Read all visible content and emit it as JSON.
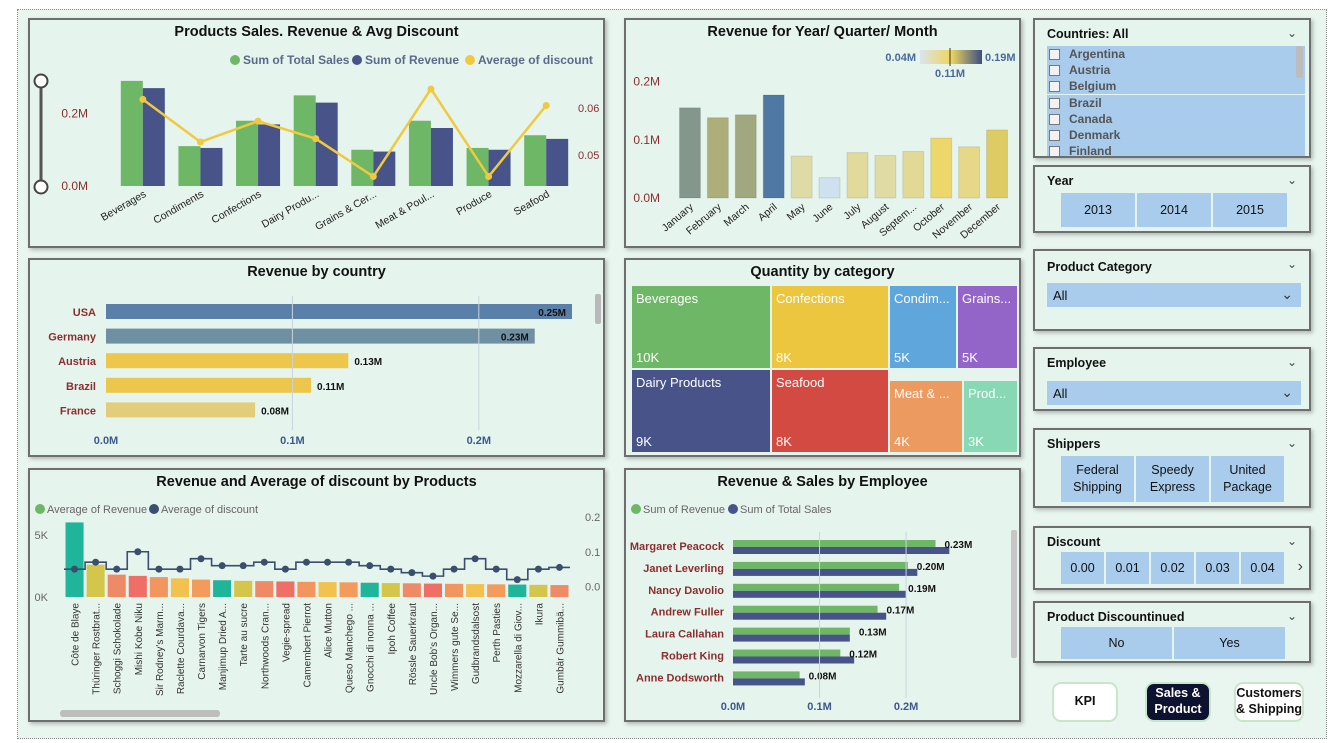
{
  "colors": {
    "green": "#6db766",
    "navy": "#475389",
    "gold": "#f0c93e",
    "maroon": "#9b3a37",
    "label": "#8b2e2e",
    "slicer_tile": "#a9ccec"
  },
  "panels": {
    "sales_revenue_discount": {
      "title": "Products Sales. Revenue & Avg Discount",
      "legend": [
        "Sum of Total Sales",
        "Sum of Revenue",
        "Average of discount"
      ],
      "y_left_ticks": [
        "0.2M",
        "0.0M"
      ],
      "y_right_ticks": [
        "0.06",
        "0.05"
      ]
    },
    "revenue_period": {
      "title": "Revenue for Year/ Quarter/ Month",
      "gradient_min": "0.04M",
      "gradient_mid": "0.11M",
      "gradient_max": "0.19M",
      "y_ticks": [
        "0.2M",
        "0.1M",
        "0.0M"
      ]
    },
    "revenue_country": {
      "title": "Revenue by country",
      "x_ticks": [
        "0.0M",
        "0.1M",
        "0.2M"
      ]
    },
    "quantity_category": {
      "title": "Quantity by category"
    },
    "revenue_discount_products": {
      "title": "Revenue and Average of discount by Products",
      "legend": [
        "Average of Revenue",
        "Average of discount"
      ],
      "y_left_ticks": [
        "5K",
        "0K"
      ],
      "y_right_ticks": [
        "0.2",
        "0.1",
        "0.0"
      ]
    },
    "revenue_sales_employee": {
      "title": "Revenue & Sales by Employee",
      "legend": [
        "Sum of Revenue",
        "Sum of Total Sales"
      ],
      "x_ticks": [
        "0.0M",
        "0.1M",
        "0.2M"
      ]
    }
  },
  "chart_data": [
    {
      "type": "bar",
      "title": "Products Sales. Revenue & Avg Discount",
      "categories": [
        "Beverages",
        "Condiments",
        "Confections",
        "Dairy Produ...",
        "Grains & Cer...",
        "Meat & Poul...",
        "Produce",
        "Seafood"
      ],
      "series": [
        {
          "name": "Sum of Total Sales",
          "values": [
            0.29,
            0.11,
            0.18,
            0.25,
            0.1,
            0.18,
            0.105,
            0.14
          ]
        },
        {
          "name": "Sum of Revenue",
          "values": [
            0.27,
            0.105,
            0.17,
            0.23,
            0.095,
            0.16,
            0.1,
            0.13
          ]
        },
        {
          "name": "Average of discount",
          "values": [
            0.0618,
            0.0528,
            0.0572,
            0.0535,
            0.0455,
            0.064,
            0.0455,
            0.0605
          ]
        }
      ],
      "ylim": [
        0,
        0.32
      ],
      "y2lim": [
        0.0435,
        0.068
      ]
    },
    {
      "type": "bar",
      "title": "Revenue for Year/ Quarter/ Month",
      "categories": [
        "January",
        "February",
        "March",
        "April",
        "May",
        "June",
        "July",
        "August",
        "Septem...",
        "October",
        "November",
        "December"
      ],
      "values": [
        0.155,
        0.138,
        0.143,
        0.177,
        0.072,
        0.035,
        0.078,
        0.073,
        0.08,
        0.103,
        0.088,
        0.117
      ],
      "ylim": [
        0,
        0.22
      ]
    },
    {
      "type": "bar",
      "title": "Revenue by country",
      "categories": [
        "USA",
        "Germany",
        "Austria",
        "Brazil",
        "France"
      ],
      "values": [
        0.25,
        0.23,
        0.13,
        0.11,
        0.08
      ],
      "labels": [
        "0.25M",
        "0.23M",
        "0.13M",
        "0.11M",
        "0.08M"
      ],
      "xlim": [
        0,
        0.25
      ]
    },
    {
      "type": "heatmap",
      "title": "Quantity by category",
      "cells": [
        {
          "label": "Beverages",
          "value": "10K",
          "color": "#6db766"
        },
        {
          "label": "Confections",
          "value": "8K",
          "color": "#ecc63e"
        },
        {
          "label": "Condim...",
          "value": "5K",
          "color": "#5fa6dc"
        },
        {
          "label": "Grains...",
          "value": "5K",
          "color": "#9465c9"
        },
        {
          "label": "Dairy Products",
          "value": "9K",
          "color": "#475389"
        },
        {
          "label": "Seafood",
          "value": "8K",
          "color": "#d24a42"
        },
        {
          "label": "Meat & ...",
          "value": "4K",
          "color": "#ec9a60"
        },
        {
          "label": "Prod...",
          "value": "3K",
          "color": "#88d7b5"
        }
      ]
    },
    {
      "type": "bar",
      "title": "Revenue and Average of discount by Products",
      "categories": [
        "Côte de Blaye",
        "Thüringer Rostbrat...",
        "Schoggi Schokolade",
        "Mishi Kobe Niku",
        "Sir Rodney's Marm...",
        "Raclette Courdava...",
        "Carnarvon Tigers",
        "Manjimup Dried A...",
        "Tarte au sucre",
        "Northwoods Cran...",
        "Vegie-spread",
        "Camembert Pierrot",
        "Alice Mutton",
        "Queso Manchego ...",
        "Gnocchi di nonna ...",
        "Ipoh Coffee",
        "Rössle Sauerkraut",
        "Uncle Bob's Organ...",
        "Wimmers gute Se...",
        "Gudbrandsdalsost",
        "Perth Pasties",
        "Mozzarella di Giov...",
        "Ikura",
        "Gumbär Gummibä..."
      ],
      "series": [
        {
          "name": "Average of Revenue",
          "values": [
            6000,
            2600,
            1800,
            1700,
            1600,
            1500,
            1400,
            1350,
            1300,
            1280,
            1250,
            1220,
            1200,
            1180,
            1150,
            1120,
            1100,
            1080,
            1060,
            1040,
            1020,
            1000,
            980,
            960
          ]
        },
        {
          "name": "Average of discount",
          "values": [
            0.05,
            0.07,
            0.05,
            0.1,
            0.05,
            0.05,
            0.08,
            0.06,
            0.06,
            0.07,
            0.05,
            0.07,
            0.07,
            0.07,
            0.06,
            0.05,
            0.04,
            0.03,
            0.05,
            0.08,
            0.05,
            0.02,
            0.05,
            0.055
          ]
        }
      ],
      "ylim": [
        0,
        7000
      ],
      "y2lim": [
        -0.03,
        0.22
      ]
    },
    {
      "type": "bar",
      "title": "Revenue & Sales by Employee",
      "categories": [
        "Margaret Peacock",
        "Janet Leverling",
        "Nancy Davolio",
        "Andrew Fuller",
        "Laura Callahan",
        "Robert King",
        "Anne Dodsworth"
      ],
      "series": [
        {
          "name": "Sum of Revenue",
          "values": [
            0.234,
            0.202,
            0.192,
            0.167,
            0.135,
            0.124,
            0.077
          ]
        },
        {
          "name": "Sum of Total Sales",
          "values": [
            0.25,
            0.213,
            0.2,
            0.177,
            0.135,
            0.14,
            0.083
          ]
        }
      ],
      "labels": [
        "0.23M",
        "0.20M",
        "0.19M",
        "0.17M",
        "0.13M",
        "0.12M",
        "0.08M"
      ],
      "xlim": [
        0,
        0.26
      ]
    }
  ],
  "slicers": {
    "countries": {
      "title": "Countries: All",
      "items": [
        "Argentina",
        "Austria",
        "Belgium",
        "Brazil",
        "Canada",
        "Denmark",
        "Finland"
      ]
    },
    "year": {
      "title": "Year",
      "options": [
        "2013",
        "2014",
        "2015"
      ]
    },
    "product_category": {
      "title": "Product Category",
      "value": "All"
    },
    "employee": {
      "title": "Employee",
      "value": "All"
    },
    "shippers": {
      "title": "Shippers",
      "options": [
        "Federal Shipping",
        "Speedy Express",
        "United Package"
      ]
    },
    "discount": {
      "title": "Discount",
      "options": [
        "0.00",
        "0.01",
        "0.02",
        "0.03",
        "0.04"
      ]
    },
    "product_discontinued": {
      "title": "Product Discountinued",
      "options": [
        "No",
        "Yes"
      ]
    }
  },
  "nav": {
    "kpi": "KPI",
    "sales_product": "Sales & Product",
    "customers_shipping": "Customers & Shipping"
  }
}
